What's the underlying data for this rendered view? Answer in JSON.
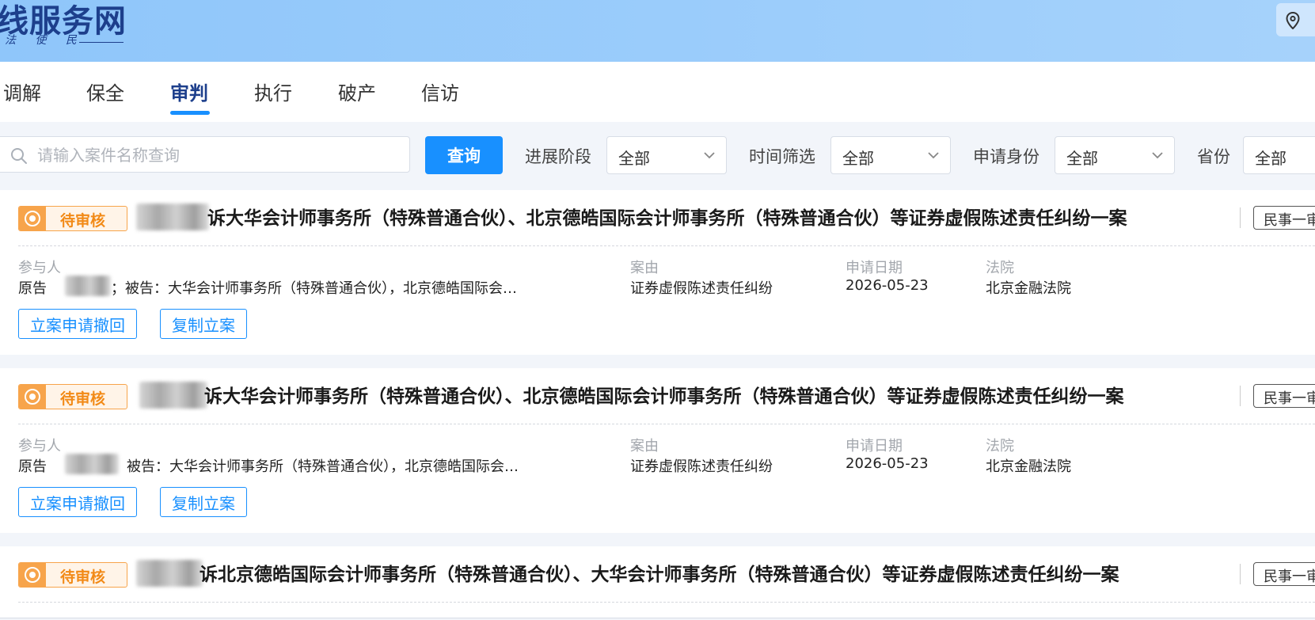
{
  "header": {
    "logo_title": "线服务网",
    "logo_subtitle": "法 使 民"
  },
  "tabs": [
    {
      "label": "调解"
    },
    {
      "label": "保全"
    },
    {
      "label": "审判"
    },
    {
      "label": "执行"
    },
    {
      "label": "破产"
    },
    {
      "label": "信访"
    }
  ],
  "active_tab": "审判",
  "filters": {
    "search_placeholder": "请输入案件名称查询",
    "query_button": "查询",
    "progress_label": "进展阶段",
    "progress_value": "全部",
    "time_label": "时间筛选",
    "time_value": "全部",
    "identity_label": "申请身份",
    "identity_value": "全部",
    "province_label": "省份",
    "province_value": "全部"
  },
  "cards": [
    {
      "status": "待审核",
      "title": "诉大华会计师事务所（特殊普通合伙）、北京德皓国际会计师事务所（特殊普通合伙）等证券虚假陈述责任纠纷一案",
      "case_type": "民事一审",
      "participants_label": "参与人",
      "participants_prefix": "原告",
      "participants_suffix": "；被告：大华会计师事务所（特殊普通合伙），北京德皓国际会…",
      "cause_label": "案由",
      "cause": "证券虚假陈述责任纠纷",
      "date_label": "申请日期",
      "date": "2026-05-23",
      "court_label": "法院",
      "court": "北京金融法院",
      "withdraw_button": "立案申请撤回",
      "copy_button": "复制立案"
    },
    {
      "status": "待审核",
      "title": "诉大华会计师事务所（特殊普通合伙）、北京德皓国际会计师事务所（特殊普通合伙）等证券虚假陈述责任纠纷一案",
      "case_type": "民事一审",
      "participants_label": "参与人",
      "participants_prefix": "原告",
      "participants_suffix": "被告：大华会计师事务所（特殊普通合伙），北京德皓国际会…",
      "cause_label": "案由",
      "cause": "证券虚假陈述责任纠纷",
      "date_label": "申请日期",
      "date": "2026-05-23",
      "court_label": "法院",
      "court": "北京金融法院",
      "withdraw_button": "立案申请撤回",
      "copy_button": "复制立案"
    },
    {
      "status": "待审核",
      "title": "诉北京德皓国际会计师事务所（特殊普通合伙）、大华会计师事务所（特殊普通合伙）等证券虚假陈述责任纠纷一案",
      "case_type": "民事一审"
    }
  ],
  "colors": {
    "primary": "#1890ff",
    "brand_navy": "#1d3f8c",
    "status_orange": "#f28a17"
  }
}
